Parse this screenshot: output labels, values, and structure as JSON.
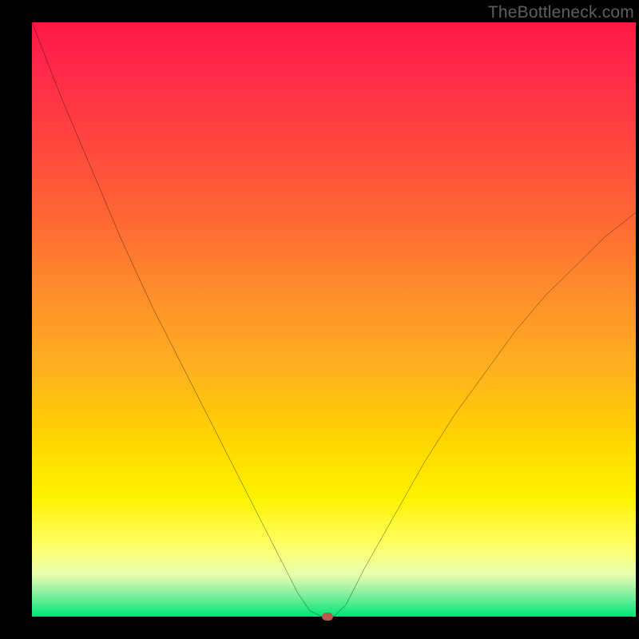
{
  "watermark": "TheBottleneck.com",
  "colors": {
    "frame": "#000000",
    "curve_stroke": "#000000",
    "marker_fill": "#b65a4a",
    "gradient_top": "#ff1744",
    "gradient_bottom": "#00e676"
  },
  "chart_data": {
    "type": "line",
    "title": "",
    "xlabel": "",
    "ylabel": "",
    "xlim": [
      0,
      100
    ],
    "ylim": [
      0,
      100
    ],
    "series": [
      {
        "name": "curve",
        "x": [
          0,
          5,
          10,
          15,
          20,
          25,
          30,
          35,
          40,
          42,
          44,
          46,
          48,
          50,
          52,
          55,
          60,
          65,
          70,
          75,
          80,
          85,
          90,
          95,
          100
        ],
        "y": [
          100,
          87,
          75,
          63,
          52,
          42,
          32,
          22,
          12,
          8,
          4,
          1,
          0,
          0,
          2,
          8,
          17,
          26,
          34,
          41,
          48,
          54,
          59,
          64,
          68
        ]
      }
    ],
    "marker": {
      "x": 49,
      "y": 0
    },
    "axes_visible": false,
    "grid": false,
    "legend": false
  }
}
